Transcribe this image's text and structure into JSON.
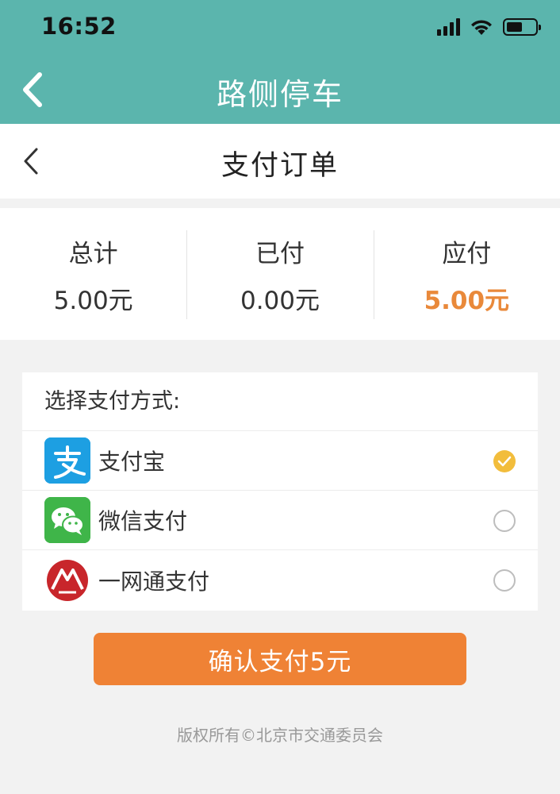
{
  "status_bar": {
    "time": "16:52"
  },
  "app_header": {
    "title": "路侧停车"
  },
  "sub_header": {
    "title": "支付订单"
  },
  "totals": [
    {
      "label": "总计",
      "value": "5.00元",
      "highlight": false
    },
    {
      "label": "已付",
      "value": "0.00元",
      "highlight": false
    },
    {
      "label": "应付",
      "value": "5.00元",
      "highlight": true
    }
  ],
  "payment": {
    "header": "选择支付方式:",
    "options": [
      {
        "name": "支付宝",
        "icon": "alipay-icon",
        "selected": true
      },
      {
        "name": "微信支付",
        "icon": "wechat-pay-icon",
        "selected": false
      },
      {
        "name": "一网通支付",
        "icon": "cmb-icon",
        "selected": false
      }
    ]
  },
  "confirm_button": {
    "label": "确认支付5元"
  },
  "footer": {
    "text": "版权所有©北京市交通委员会"
  },
  "colors": {
    "header_teal": "#5bb5ad",
    "accent_orange": "#ef8235",
    "amount_orange": "#e9893a",
    "checked_yellow": "#f2bd3c"
  }
}
